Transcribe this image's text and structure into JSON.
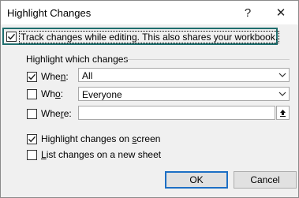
{
  "dialog": {
    "title": "Highlight Changes",
    "help_glyph": "?",
    "close_glyph": "✕"
  },
  "track": {
    "label": "Track changes while editing. This also shares your workbook.",
    "checked": true
  },
  "group": {
    "label": "Highlight which changes"
  },
  "when": {
    "label_pre": "Whe",
    "label_u": "n",
    "label_post": ":",
    "checked": true,
    "value": "All"
  },
  "who": {
    "label_pre": "Wh",
    "label_u": "o",
    "label_post": ":",
    "checked": false,
    "value": "Everyone"
  },
  "where": {
    "label_pre": "Whe",
    "label_u": "r",
    "label_post": "e:",
    "checked": false,
    "value": ""
  },
  "onscreen": {
    "label_pre": "Highlight changes on ",
    "label_u": "s",
    "label_post": "creen",
    "checked": true
  },
  "newsheet": {
    "label_u": "L",
    "label_post": "ist changes on a new sheet",
    "checked": false
  },
  "buttons": {
    "ok": "OK",
    "cancel": "Cancel"
  },
  "colors": {
    "focus_frame": "#1f6e6e",
    "default_button_border": "#1d6fc4"
  }
}
